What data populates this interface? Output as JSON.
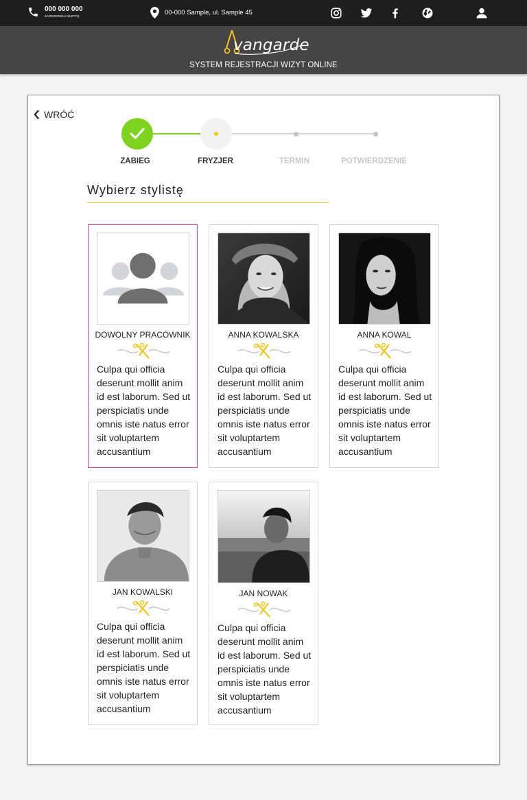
{
  "topbar": {
    "phone": "000 000 000",
    "phone_sub": "ZAREZERWUJ WIZYTĘ",
    "address": "00-000 Sample, ul. Sample 45",
    "socials": [
      "instagram-icon",
      "twitter-icon",
      "facebook-icon",
      "globe-icon"
    ],
    "user_icon": "user-icon"
  },
  "header": {
    "brand": "vangarde",
    "subtitle": "SYSTEM REJESTRACJI WIZYT ONLINE"
  },
  "nav": {
    "back_label": "WRÓĆ"
  },
  "steps": [
    {
      "label": "ZABIEG",
      "state": "done"
    },
    {
      "label": "FRYZJER",
      "state": "current"
    },
    {
      "label": "TERMIN",
      "state": "pending"
    },
    {
      "label": "POTWIERDZENIE",
      "state": "pending"
    }
  ],
  "section_title": "Wybierz stylistę",
  "stylists": [
    {
      "name": "DOWOLNY PRACOWNIK",
      "desc": "Culpa qui officia deserunt mollit anim id est laborum. Sed ut perspiciatis unde omnis iste natus error sit voluptartem accusantium",
      "selected": true
    },
    {
      "name": "ANNA KOWALSKA",
      "desc": "Culpa qui officia deserunt mollit anim id est laborum. Sed ut perspiciatis unde omnis iste natus error sit voluptartem accusantium",
      "selected": false
    },
    {
      "name": "ANNA KOWAL",
      "desc": "Culpa qui officia deserunt mollit anim id est laborum. Sed ut perspiciatis unde omnis iste natus error sit voluptartem accusantium",
      "selected": false
    },
    {
      "name": "JAN KOWALSKI",
      "desc": "Culpa qui officia deserunt mollit anim id est laborum. Sed ut perspiciatis unde omnis iste natus error sit voluptartem accusantium",
      "selected": false
    },
    {
      "name": "JAN NOWAK",
      "desc": "Culpa qui officia deserunt mollit anim id est laborum. Sed ut perspiciatis unde omnis iste natus error sit voluptartem accusantium",
      "selected": false
    }
  ],
  "colors": {
    "accent_yellow": "#f0c419",
    "step_done": "#7ed321",
    "selected_border": "#e0409a",
    "header_bg": "#454545",
    "topbar_bg": "#1e1e1e"
  }
}
